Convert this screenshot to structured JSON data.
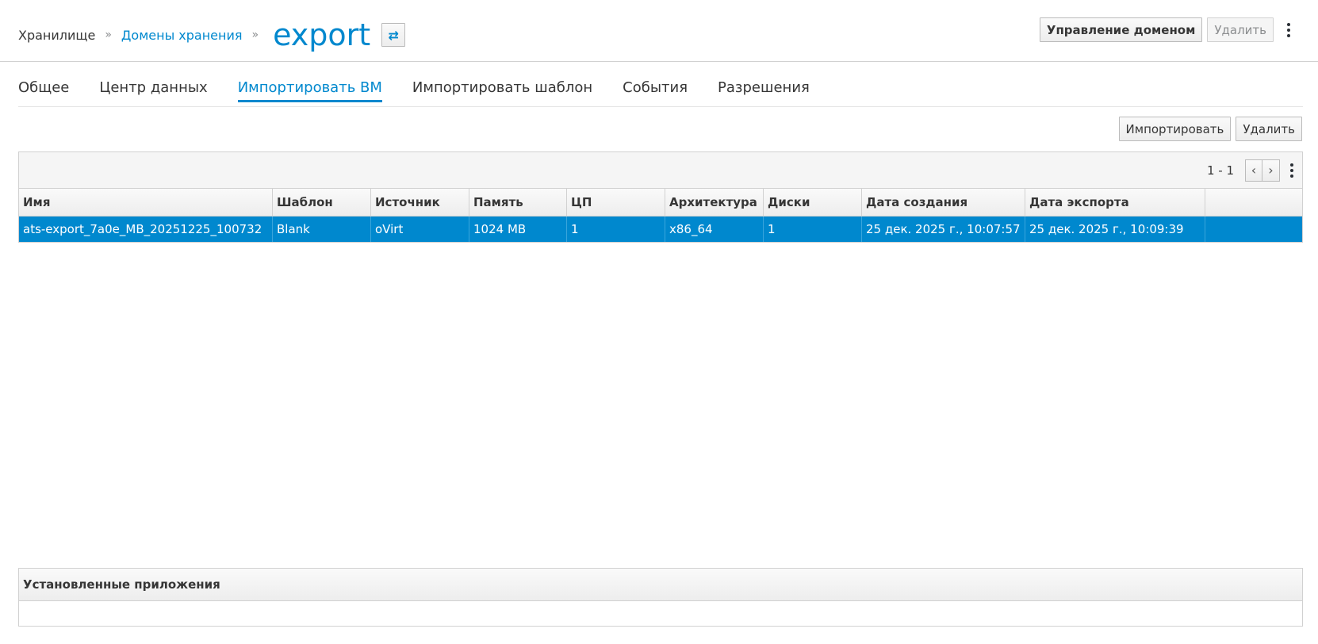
{
  "breadcrumb": {
    "items": [
      "Хранилище",
      "Домены хранения"
    ],
    "separator": "»",
    "title": "export"
  },
  "header_actions": {
    "manage_domain": "Управление доменом",
    "remove": "Удалить"
  },
  "tabs": [
    {
      "label": "Общее",
      "active": false
    },
    {
      "label": "Центр данных",
      "active": false
    },
    {
      "label": "Импортировать ВМ",
      "active": true
    },
    {
      "label": "Импортировать шаблон",
      "active": false
    },
    {
      "label": "События",
      "active": false
    },
    {
      "label": "Разрешения",
      "active": false
    }
  ],
  "table_actions": {
    "import": "Импортировать",
    "remove": "Удалить"
  },
  "pager": {
    "range": "1 - 1",
    "prev_icon": "chevron-left-icon",
    "next_icon": "chevron-right-icon"
  },
  "table": {
    "columns": [
      "Имя",
      "Шаблон",
      "Источник",
      "Память",
      "ЦП",
      "Архитектура",
      "Диски",
      "Дата создания",
      "Дата экспорта"
    ],
    "rows": [
      [
        "ats-export_7a0e_MB_20251225_100732",
        "Blank",
        "oVirt",
        "1024 MB",
        "1",
        "x86_64",
        "1",
        "25 дек. 2025 г., 10:07:57",
        "25 дек. 2025 г., 10:09:39"
      ]
    ],
    "selected_row": 0,
    "selected_color": "#0088ce"
  },
  "installed_apps": {
    "title": "Установленные приложения"
  },
  "colors": {
    "accent": "#0088ce",
    "text": "#363636",
    "border": "#d1d1d1"
  }
}
